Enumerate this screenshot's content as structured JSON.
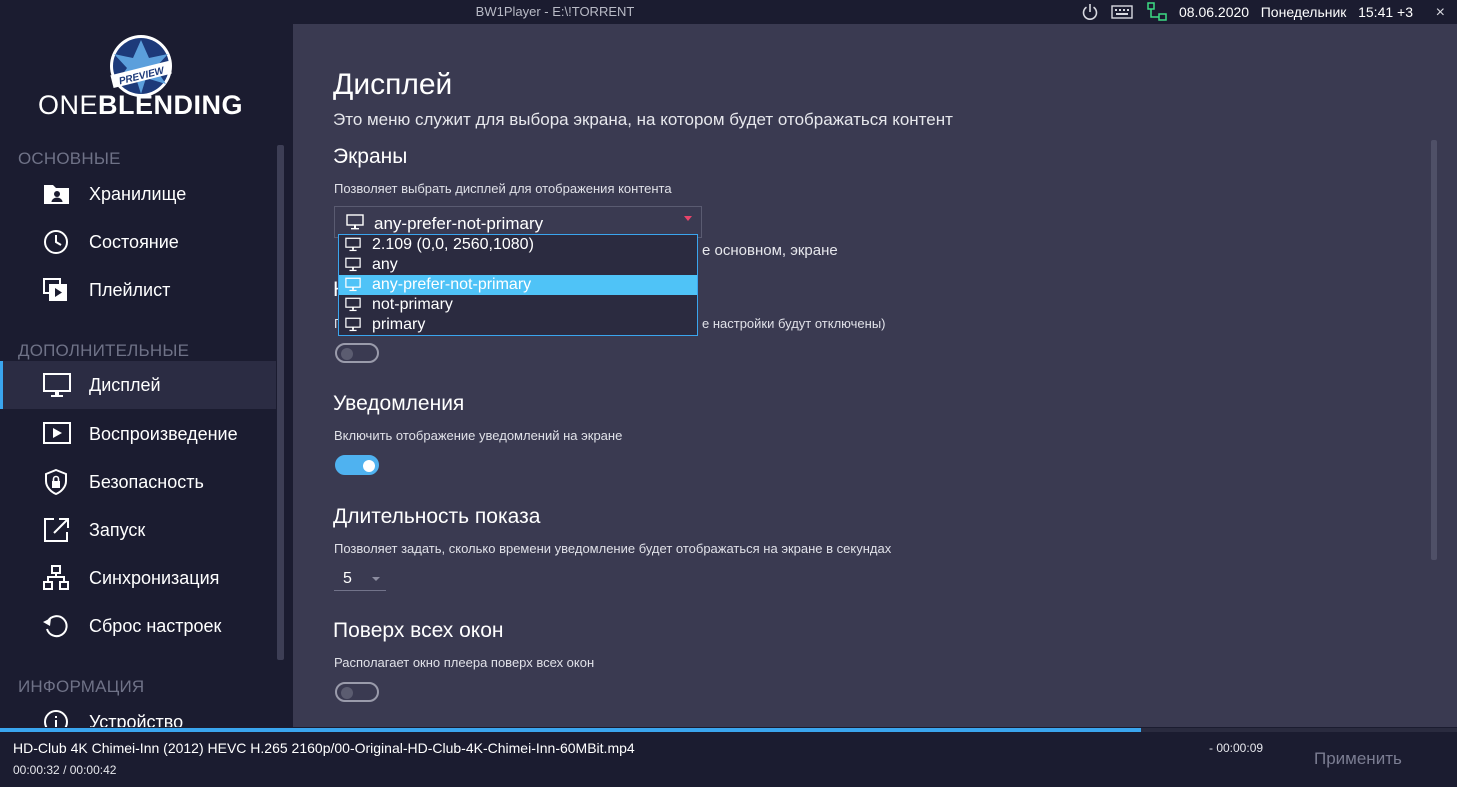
{
  "window": {
    "title": "BW1Player - E:\\!TORRENT",
    "date": "08.06.2020",
    "weekday": "Понедельник",
    "time": "15:41 +3",
    "close": "×"
  },
  "logo": {
    "badge": "PREVIEW",
    "name_light": "ONE",
    "name_bold": "BLENDING"
  },
  "sidebar": {
    "sections": [
      {
        "label": "ОСНОВНЫЕ"
      },
      {
        "label": "ДОПОЛНИТЕЛЬНЫЕ"
      },
      {
        "label": "ИНФОРМАЦИЯ"
      }
    ],
    "items": [
      {
        "label": "Хранилище",
        "icon": "folder-user-icon"
      },
      {
        "label": "Состояние",
        "icon": "clock-icon"
      },
      {
        "label": "Плейлист",
        "icon": "playlist-icon"
      },
      {
        "label": "Дисплей",
        "icon": "monitor-icon",
        "active": true
      },
      {
        "label": "Воспроизведение",
        "icon": "play-screen-icon"
      },
      {
        "label": "Безопасность",
        "icon": "shield-lock-icon"
      },
      {
        "label": "Запуск",
        "icon": "launch-icon"
      },
      {
        "label": "Синхронизация",
        "icon": "network-icon"
      },
      {
        "label": "Сброс настроек",
        "icon": "reset-icon"
      },
      {
        "label": "Устройство",
        "icon": "info-icon"
      }
    ]
  },
  "main": {
    "title": "Дисплей",
    "subtitle": "Это меню служит для выбора экрана, на котором будет отображаться контент",
    "screens": {
      "title": "Экраны",
      "desc": "Позволяет выбрать дисплей для отображения контента",
      "value": "any-prefer-not-primary",
      "options": [
        "2.109 (0,0, 2560,1080)",
        "any",
        "any-prefer-not-primary",
        "not-primary",
        "primary"
      ],
      "selected_index": 2,
      "partial_text_1": "е основном, экране",
      "partial_text_2": "е настройки будут отключены)"
    },
    "notifications": {
      "title": "Уведомления",
      "desc": "Включить отображение уведомлений на экране",
      "enabled": true
    },
    "duration": {
      "title": "Длительность показа",
      "desc": "Позволяет задать, сколько времени уведомление будет отображаться на экране в секундах",
      "value": "5"
    },
    "on_top": {
      "title": "Поверх всех окон",
      "desc": "Располагает окно плеера поверх всех окон",
      "enabled": false
    },
    "hidden_toggle_enabled": false
  },
  "player": {
    "file": "HD-Club 4K Chimei-Inn (2012) HEVC H.265 2160p/00-Original-HD-Club-4K-Chimei-Inn-60MBit.mp4",
    "elapsed": "00:00:32",
    "total": "00:00:42",
    "separator": "/",
    "remaining": "- 00:00:09",
    "progress": 0.783
  },
  "actions": {
    "apply": "Применить"
  },
  "colors": {
    "accent": "#3aa5ee",
    "selection": "#4fc3f7",
    "arrow": "#e9446a",
    "network_icon": "#3ddc84"
  }
}
